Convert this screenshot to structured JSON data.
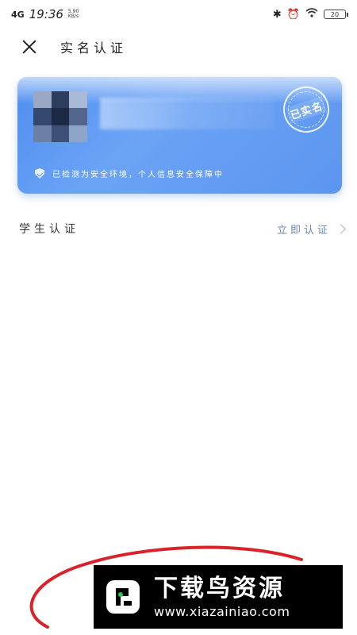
{
  "status_bar": {
    "network": "4G",
    "time": "19:36",
    "speed": "5.90 KB/s",
    "battery": "20"
  },
  "header": {
    "title": "实名认证"
  },
  "id_card": {
    "stamp": "已实名",
    "secure_text": "已检测为安全环境，个人信息安全保障中",
    "gradient_start": "#4e8ef0",
    "gradient_end": "#5c95ef"
  },
  "student": {
    "label": "学生认证",
    "action": "立即认证"
  },
  "watermark": {
    "title": "下载鸟资源",
    "url": "www.xiazainiao.com"
  },
  "colors": {
    "link": "#6b87b5",
    "annotation": "#d8232a"
  }
}
